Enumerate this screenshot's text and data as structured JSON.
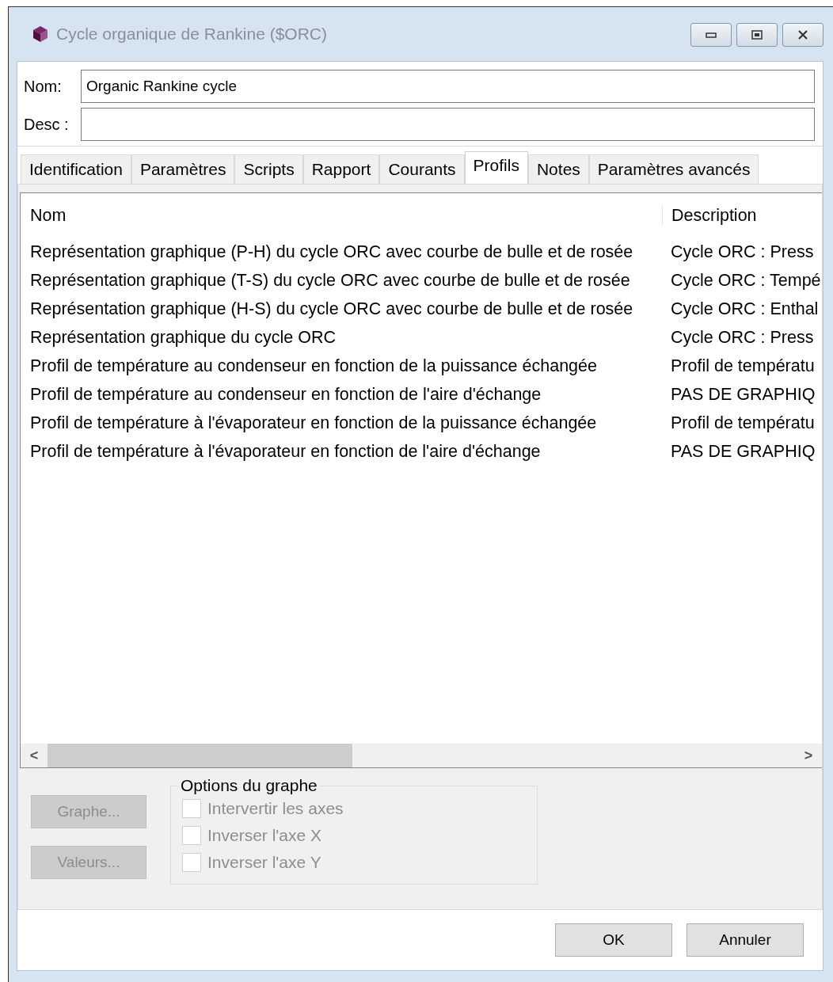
{
  "window": {
    "title": "Cycle organique de Rankine ($ORC)"
  },
  "form": [
    {
      "label": "Nom:",
      "value": "Organic Rankine cycle"
    },
    {
      "label": "Desc :"
    }
  ],
  "tabs": [
    {
      "label": "Identification",
      "selected": false
    },
    {
      "label": "Paramètres",
      "selected": false
    },
    {
      "label": "Scripts",
      "selected": false
    },
    {
      "label": "Rapport",
      "selected": false
    },
    {
      "label": "Courants",
      "selected": false
    },
    {
      "label": "Profils",
      "selected": true
    },
    {
      "label": "Notes",
      "selected": false
    },
    {
      "label": "Paramètres avancés",
      "selected": false
    }
  ],
  "table": {
    "columns": [
      "Nom",
      "Description"
    ],
    "rows": [
      [
        "Représentation graphique (P-H) du cycle ORC avec courbe de bulle et de rosée",
        "Cycle ORC : Press"
      ],
      [
        "Représentation graphique (T-S) du cycle ORC avec courbe de bulle et de rosée",
        "Cycle ORC : Tempé"
      ],
      [
        "Représentation graphique (H-S) du cycle ORC avec courbe de bulle et de rosée",
        "Cycle ORC : Enthal"
      ],
      [
        "Représentation graphique du cycle ORC",
        "Cycle ORC : Press"
      ],
      [
        "Profil de température au condenseur en fonction de la puissance échangée",
        "Profil de températu"
      ],
      [
        "Profil de température au condenseur en fonction de l'aire d'échange",
        "PAS DE GRAPHIQ"
      ],
      [
        "Profil de température à l'évaporateur en fonction de la puissance échangée",
        "Profil de températu"
      ],
      [
        "Profil de température à l'évaporateur en fonction de l'aire d'échange",
        "PAS DE GRAPHIQ"
      ]
    ],
    "scroll_left": "<",
    "scroll_right": ">"
  },
  "actions": [
    {
      "label": "Graphe...",
      "disabled": true
    },
    {
      "label": "Valeurs...",
      "disabled": true
    }
  ],
  "graph_options": {
    "title": "Options du graphe",
    "options": [
      {
        "label": "Intervertir les axes",
        "checked": false,
        "disabled": true
      },
      {
        "label": "Inverser l'axe X",
        "checked": false,
        "disabled": true
      },
      {
        "label": "Inverser l'axe Y",
        "checked": false,
        "disabled": true
      }
    ]
  },
  "buttons": [
    "OK",
    "Annuler"
  ]
}
